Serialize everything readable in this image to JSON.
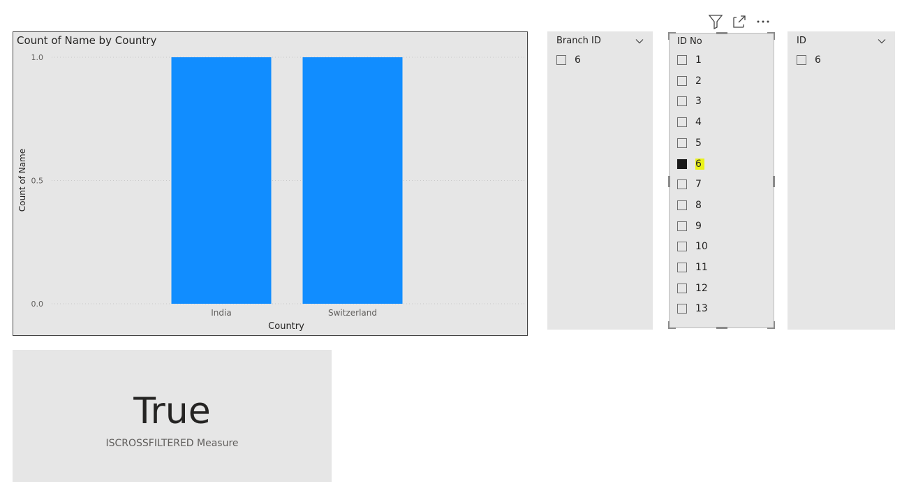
{
  "header_icons": [
    "filter-icon",
    "focus-mode-icon",
    "more-options-icon"
  ],
  "chart_data": {
    "type": "bar",
    "title": "Count of Name by Country",
    "xlabel": "Country",
    "ylabel": "Count of Name",
    "categories": [
      "India",
      "Switzerland"
    ],
    "values": [
      1,
      1
    ],
    "ylim": [
      0,
      1
    ],
    "yticks": [
      "0.0",
      "0.5",
      "1.0"
    ],
    "grid": true,
    "bar_color": "#118dff"
  },
  "branch_slicer": {
    "title": "Branch ID",
    "items": [
      {
        "label": "6",
        "checked": false
      }
    ]
  },
  "idno_slicer": {
    "title": "ID No",
    "items": [
      {
        "label": "1",
        "checked": false
      },
      {
        "label": "2",
        "checked": false
      },
      {
        "label": "3",
        "checked": false
      },
      {
        "label": "4",
        "checked": false
      },
      {
        "label": "5",
        "checked": false
      },
      {
        "label": "6",
        "checked": true
      },
      {
        "label": "7",
        "checked": false
      },
      {
        "label": "8",
        "checked": false
      },
      {
        "label": "9",
        "checked": false
      },
      {
        "label": "10",
        "checked": false
      },
      {
        "label": "11",
        "checked": false
      },
      {
        "label": "12",
        "checked": false
      },
      {
        "label": "13",
        "checked": false
      }
    ],
    "highlight_color": "#eaf21a"
  },
  "id_slicer": {
    "title": "ID",
    "items": [
      {
        "label": "6",
        "checked": false
      }
    ]
  },
  "card": {
    "value": "True",
    "label": "ISCROSSFILTERED Measure"
  }
}
